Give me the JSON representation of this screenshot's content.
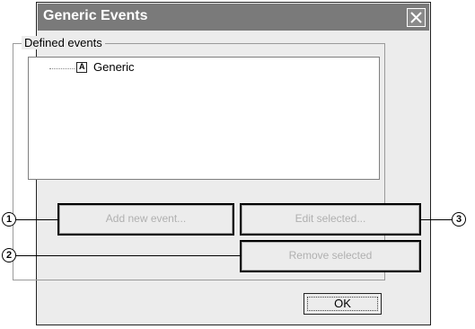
{
  "window": {
    "title": "Generic Events"
  },
  "group": {
    "label": "Defined events"
  },
  "tree": {
    "items": [
      {
        "icon": "event-icon",
        "icon_glyph": "A",
        "label": "Generic"
      }
    ]
  },
  "buttons": {
    "add_new_event": "Add new event...",
    "edit_selected": "Edit selected...",
    "remove_selected": "Remove selected",
    "ok": "OK"
  },
  "callouts": [
    "1",
    "2",
    "3"
  ]
}
